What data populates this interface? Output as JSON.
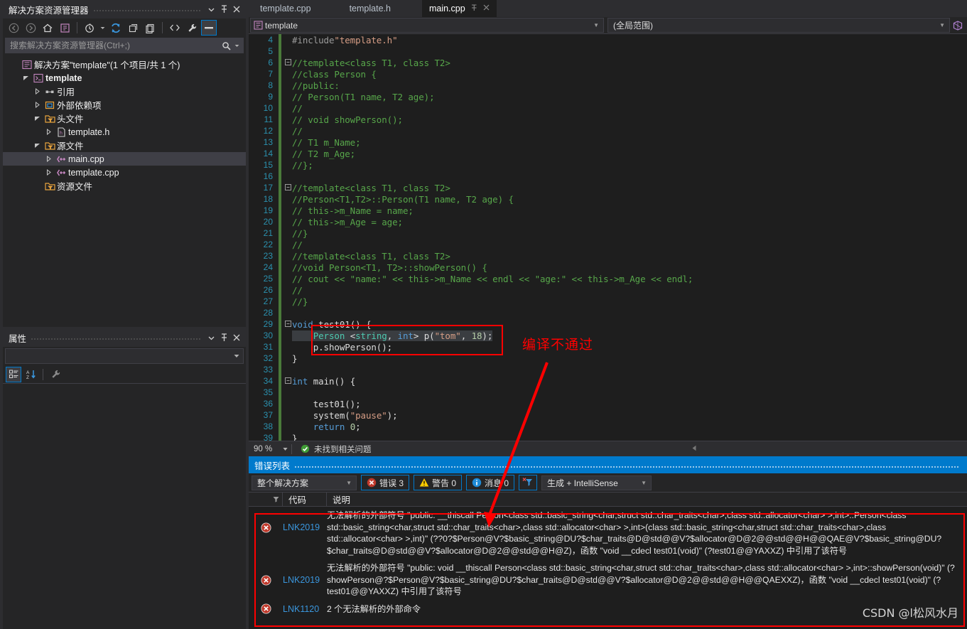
{
  "solution_explorer": {
    "title": "解决方案资源管理器",
    "caption_buttons": [
      "▼",
      "📌",
      "✕"
    ],
    "toolbar_icons": [
      "back-arrow",
      "forward-arrow",
      "home",
      "solution-view",
      "pending-changes",
      "refresh",
      "collapse-all",
      "show-all-files",
      "code-view",
      "properties-wrench",
      "minimize"
    ],
    "search_placeholder": "搜索解决方案资源管理器(Ctrl+;)",
    "search_value": "",
    "tree": [
      {
        "label": "解决方案\"template\"(1 个项目/共 1 个)",
        "indent": 0,
        "twisty": "",
        "icon": "solution-icon",
        "bold": false,
        "selected": false
      },
      {
        "label": "template",
        "indent": 1,
        "twisty": "expanded",
        "icon": "project-icon",
        "bold": true,
        "selected": false
      },
      {
        "label": "引用",
        "indent": 2,
        "twisty": "collapsed",
        "icon": "references-icon",
        "bold": false,
        "selected": false
      },
      {
        "label": "外部依赖项",
        "indent": 2,
        "twisty": "collapsed",
        "icon": "external-deps-icon",
        "bold": false,
        "selected": false
      },
      {
        "label": "头文件",
        "indent": 2,
        "twisty": "expanded",
        "icon": "folder-filter-icon",
        "bold": false,
        "selected": false
      },
      {
        "label": "template.h",
        "indent": 3,
        "twisty": "collapsed",
        "icon": "header-file-icon",
        "bold": false,
        "selected": false
      },
      {
        "label": "源文件",
        "indent": 2,
        "twisty": "expanded",
        "icon": "folder-filter-icon",
        "bold": false,
        "selected": false
      },
      {
        "label": "main.cpp",
        "indent": 3,
        "twisty": "collapsed",
        "icon": "cpp-file-icon",
        "bold": false,
        "selected": true
      },
      {
        "label": "template.cpp",
        "indent": 3,
        "twisty": "collapsed",
        "icon": "cpp-file-icon",
        "bold": false,
        "selected": false
      },
      {
        "label": "资源文件",
        "indent": 2,
        "twisty": "",
        "icon": "folder-filter-icon",
        "bold": false,
        "selected": false
      }
    ]
  },
  "properties": {
    "title": "属性",
    "caption_buttons": [
      "▼",
      "📌",
      "✕"
    ],
    "object_value": "",
    "toolbar_icons": [
      "categorized-icon",
      "alphabetical-sort-icon",
      "property-pages-wrench-icon"
    ]
  },
  "editor": {
    "tabs": [
      {
        "label": "template.cpp",
        "active": false,
        "pinned": false,
        "closable": false
      },
      {
        "label": "template.h",
        "active": false,
        "pinned": false,
        "closable": false
      },
      {
        "label": "main.cpp",
        "active": true,
        "pinned": true,
        "closable": true
      }
    ],
    "nav_scope": "template",
    "nav_member": "(全局范围)",
    "zoom": "90 %",
    "status_text": "未找到相关问题",
    "lines": [
      {
        "n": 4,
        "fold": "",
        "spans": [
          {
            "t": "#include",
            "c": "c-pp"
          },
          {
            "t": "\"template.h\"",
            "c": "c-str"
          }
        ]
      },
      {
        "n": 5,
        "fold": "",
        "spans": []
      },
      {
        "n": 6,
        "fold": "-",
        "spans": [
          {
            "t": "//template<class T1, class T2>",
            "c": "c-cmt"
          }
        ]
      },
      {
        "n": 7,
        "fold": "",
        "spans": [
          {
            "t": "//class Person {",
            "c": "c-cmt"
          }
        ]
      },
      {
        "n": 8,
        "fold": "",
        "spans": [
          {
            "t": "//public:",
            "c": "c-cmt"
          }
        ]
      },
      {
        "n": 9,
        "fold": "",
        "spans": [
          {
            "t": "// Person(T1 name, T2 age);",
            "c": "c-cmt"
          }
        ]
      },
      {
        "n": 10,
        "fold": "",
        "spans": [
          {
            "t": "//",
            "c": "c-cmt"
          }
        ]
      },
      {
        "n": 11,
        "fold": "",
        "spans": [
          {
            "t": "// void showPerson();",
            "c": "c-cmt"
          }
        ]
      },
      {
        "n": 12,
        "fold": "",
        "spans": [
          {
            "t": "//",
            "c": "c-cmt"
          }
        ]
      },
      {
        "n": 13,
        "fold": "",
        "spans": [
          {
            "t": "// T1 m_Name;",
            "c": "c-cmt"
          }
        ]
      },
      {
        "n": 14,
        "fold": "",
        "spans": [
          {
            "t": "// T2 m_Age;",
            "c": "c-cmt"
          }
        ]
      },
      {
        "n": 15,
        "fold": "",
        "spans": [
          {
            "t": "//};",
            "c": "c-cmt"
          }
        ]
      },
      {
        "n": 16,
        "fold": "",
        "spans": []
      },
      {
        "n": 17,
        "fold": "-",
        "spans": [
          {
            "t": "//template<class T1, class T2>",
            "c": "c-cmt"
          }
        ]
      },
      {
        "n": 18,
        "fold": "",
        "spans": [
          {
            "t": "//Person<T1,T2>::Person(T1 name, T2 age) {",
            "c": "c-cmt"
          }
        ]
      },
      {
        "n": 19,
        "fold": "",
        "spans": [
          {
            "t": "// this->m_Name = name;",
            "c": "c-cmt"
          }
        ]
      },
      {
        "n": 20,
        "fold": "",
        "spans": [
          {
            "t": "// this->m_Age = age;",
            "c": "c-cmt"
          }
        ]
      },
      {
        "n": 21,
        "fold": "",
        "spans": [
          {
            "t": "//}",
            "c": "c-cmt"
          }
        ]
      },
      {
        "n": 22,
        "fold": "",
        "spans": [
          {
            "t": "//",
            "c": "c-cmt"
          }
        ]
      },
      {
        "n": 23,
        "fold": "",
        "spans": [
          {
            "t": "//template<class T1, class T2>",
            "c": "c-cmt"
          }
        ]
      },
      {
        "n": 24,
        "fold": "",
        "spans": [
          {
            "t": "//void Person<T1, T2>::showPerson() {",
            "c": "c-cmt"
          }
        ]
      },
      {
        "n": 25,
        "fold": "",
        "spans": [
          {
            "t": "// cout << \"name:\" << this->m_Name << endl << \"age:\" << this->m_Age << endl;",
            "c": "c-cmt"
          }
        ]
      },
      {
        "n": 26,
        "fold": "",
        "spans": [
          {
            "t": "//",
            "c": "c-cmt"
          }
        ]
      },
      {
        "n": 27,
        "fold": "",
        "spans": [
          {
            "t": "//}",
            "c": "c-cmt"
          }
        ]
      },
      {
        "n": 28,
        "fold": "",
        "spans": []
      },
      {
        "n": 29,
        "fold": "-",
        "spans": [
          {
            "t": "void",
            "c": "c-kw"
          },
          {
            "t": " ",
            "c": "c-plain"
          },
          {
            "t": "test01",
            "c": "c-plain"
          },
          {
            "t": "() {",
            "c": "c-plain"
          }
        ]
      },
      {
        "n": 30,
        "fold": "",
        "spans": [
          {
            "t": "    ",
            "c": "c-plain"
          },
          {
            "t": "Person",
            "c": "c-type"
          },
          {
            "t": " <",
            "c": "c-plain"
          },
          {
            "t": "string",
            "c": "c-type"
          },
          {
            "t": ", ",
            "c": "c-plain"
          },
          {
            "t": "int",
            "c": "c-kw"
          },
          {
            "t": "> ",
            "c": "c-plain"
          },
          {
            "t": "p",
            "c": "c-plain"
          },
          {
            "t": "(",
            "c": "c-plain"
          },
          {
            "t": "\"tom\"",
            "c": "c-str"
          },
          {
            "t": ", ",
            "c": "c-plain"
          },
          {
            "t": "18",
            "c": "c-num"
          },
          {
            "t": ");",
            "c": "c-plain"
          }
        ]
      },
      {
        "n": 31,
        "fold": "",
        "spans": [
          {
            "t": "    ",
            "c": "c-plain"
          },
          {
            "t": "p.showPerson();",
            "c": "c-plain"
          }
        ]
      },
      {
        "n": 32,
        "fold": "",
        "spans": [
          {
            "t": "}",
            "c": "c-plain"
          }
        ]
      },
      {
        "n": 33,
        "fold": "",
        "spans": []
      },
      {
        "n": 34,
        "fold": "-",
        "spans": [
          {
            "t": "int",
            "c": "c-kw"
          },
          {
            "t": " ",
            "c": "c-plain"
          },
          {
            "t": "main",
            "c": "c-plain"
          },
          {
            "t": "() {",
            "c": "c-plain"
          }
        ]
      },
      {
        "n": 35,
        "fold": "",
        "spans": []
      },
      {
        "n": 36,
        "fold": "",
        "spans": [
          {
            "t": "    ",
            "c": "c-plain"
          },
          {
            "t": "test01();",
            "c": "c-plain"
          }
        ]
      },
      {
        "n": 37,
        "fold": "",
        "spans": [
          {
            "t": "    ",
            "c": "c-plain"
          },
          {
            "t": "system(",
            "c": "c-plain"
          },
          {
            "t": "\"pause\"",
            "c": "c-str"
          },
          {
            "t": ");",
            "c": "c-plain"
          }
        ]
      },
      {
        "n": 38,
        "fold": "",
        "spans": [
          {
            "t": "    ",
            "c": "c-plain"
          },
          {
            "t": "return",
            "c": "c-kw"
          },
          {
            "t": " ",
            "c": "c-plain"
          },
          {
            "t": "0",
            "c": "c-num"
          },
          {
            "t": ";",
            "c": "c-plain"
          }
        ]
      },
      {
        "n": 39,
        "fold": "",
        "spans": [
          {
            "t": "}",
            "c": "c-plain"
          }
        ]
      }
    ]
  },
  "error_list": {
    "title": "错误列表",
    "scope_filter": "整个解决方案",
    "errors_label": "错误 3",
    "warnings_label": "警告 0",
    "messages_label": "消息 0",
    "build_filter": "生成 + IntelliSense",
    "columns": [
      "",
      "代码",
      "说明"
    ],
    "rows": [
      {
        "severity": "error",
        "code": "LNK2019",
        "description": "无法解析的外部符号 \"public: __thiscall Person<class std::basic_string<char,struct std::char_traits<char>,class std::allocator<char> >,int>::Person<class std::basic_string<char,struct std::char_traits<char>,class std::allocator<char> >,int>(class std::basic_string<char,struct std::char_traits<char>,class std::allocator<char> >,int)\" (??0?$Person@V?$basic_string@DU?$char_traits@D@std@@V?$allocator@D@2@@std@@H@@QAE@V?$basic_string@DU?$char_traits@D@std@@V?$allocator@D@2@@std@@H@Z)，函数 \"void __cdecl test01(void)\" (?test01@@YAXXZ) 中引用了该符号"
      },
      {
        "severity": "error",
        "code": "LNK2019",
        "description": "无法解析的外部符号 \"public: void __thiscall Person<class std::basic_string<char,struct std::char_traits<char>,class std::allocator<char> >,int>::showPerson(void)\" (?showPerson@?$Person@V?$basic_string@DU?$char_traits@D@std@@V?$allocator@D@2@@std@@H@@QAEXXZ)，函数 \"void __cdecl test01(void)\" (?test01@@YAXXZ) 中引用了该符号"
      },
      {
        "severity": "error",
        "code": "LNK1120",
        "description": "2 个无法解析的外部命令"
      }
    ]
  },
  "annotations": {
    "compile_fail_text": "编译不通过",
    "highlight_color": "#ff0000",
    "watermark": "CSDN @l松风水月"
  }
}
